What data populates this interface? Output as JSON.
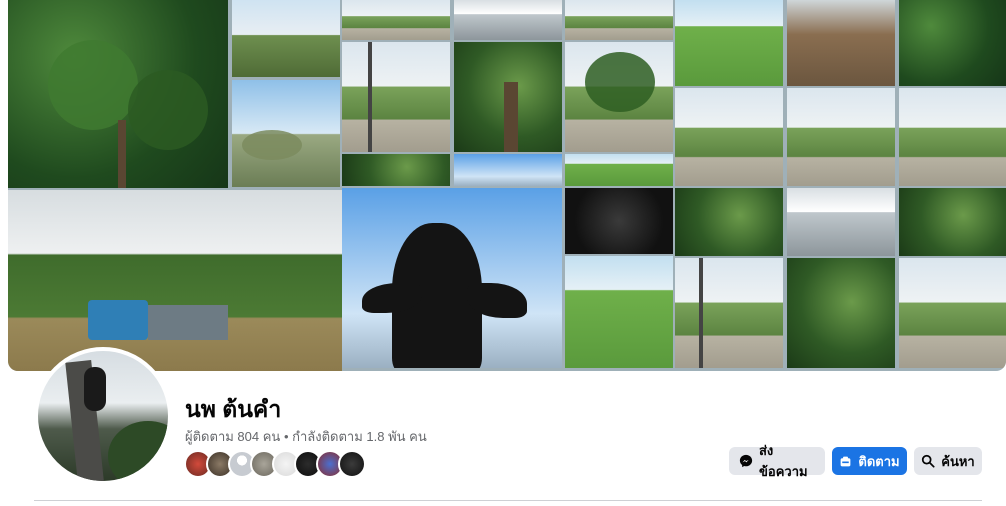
{
  "profile": {
    "name": "นพ ต้นคำ",
    "followers_text": "ผู้ติดตาม 804 คน",
    "separator": "•",
    "following_text": "กำลังติดตาม 1.8 พัน คน"
  },
  "actions": {
    "message_label": "ส่งข้อความ",
    "follow_label": "ติดตาม",
    "search_label": "ค้นหา"
  },
  "colors": {
    "accent": "#1b74e4",
    "secondary_button": "#e4e6eb",
    "muted_text": "#65676b"
  },
  "follower_avatars_count": 8
}
